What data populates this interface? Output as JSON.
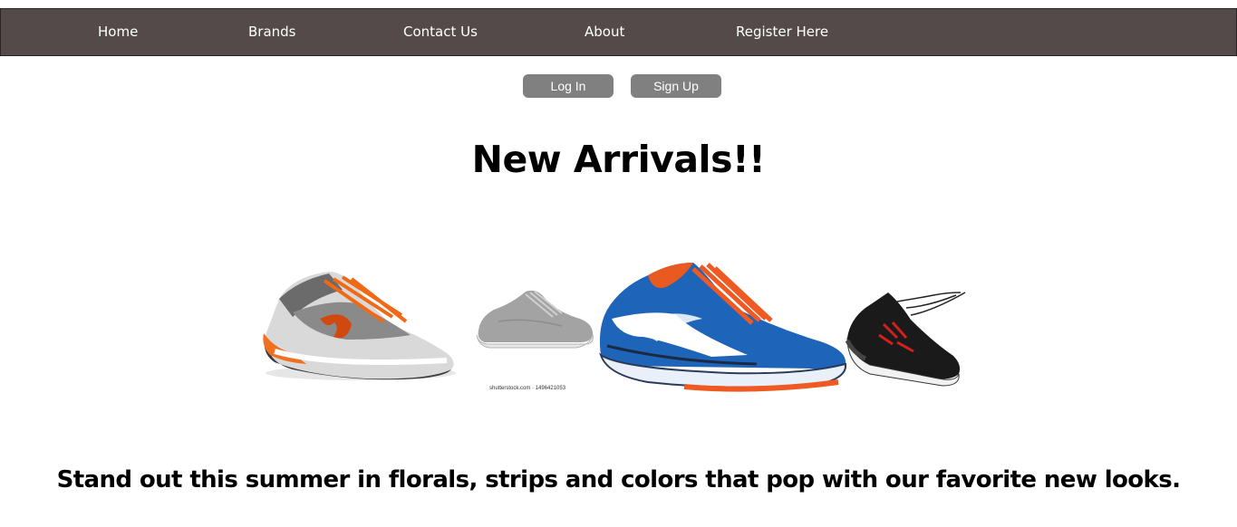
{
  "nav": {
    "home": "Home",
    "brands": "Brands",
    "contact": "Contact Us",
    "about": "About",
    "register": "Register Here"
  },
  "auth": {
    "login": "Log In",
    "signup": "Sign Up"
  },
  "main": {
    "heading": "New Arrivals!!",
    "image_caption": "shutterstock.com · 1496421053",
    "tagline": "Stand out this summer in florals, strips and colors that pop with our favorite new looks."
  },
  "colors": {
    "nav_bg": "#554a4a",
    "button_bg": "#808080"
  }
}
